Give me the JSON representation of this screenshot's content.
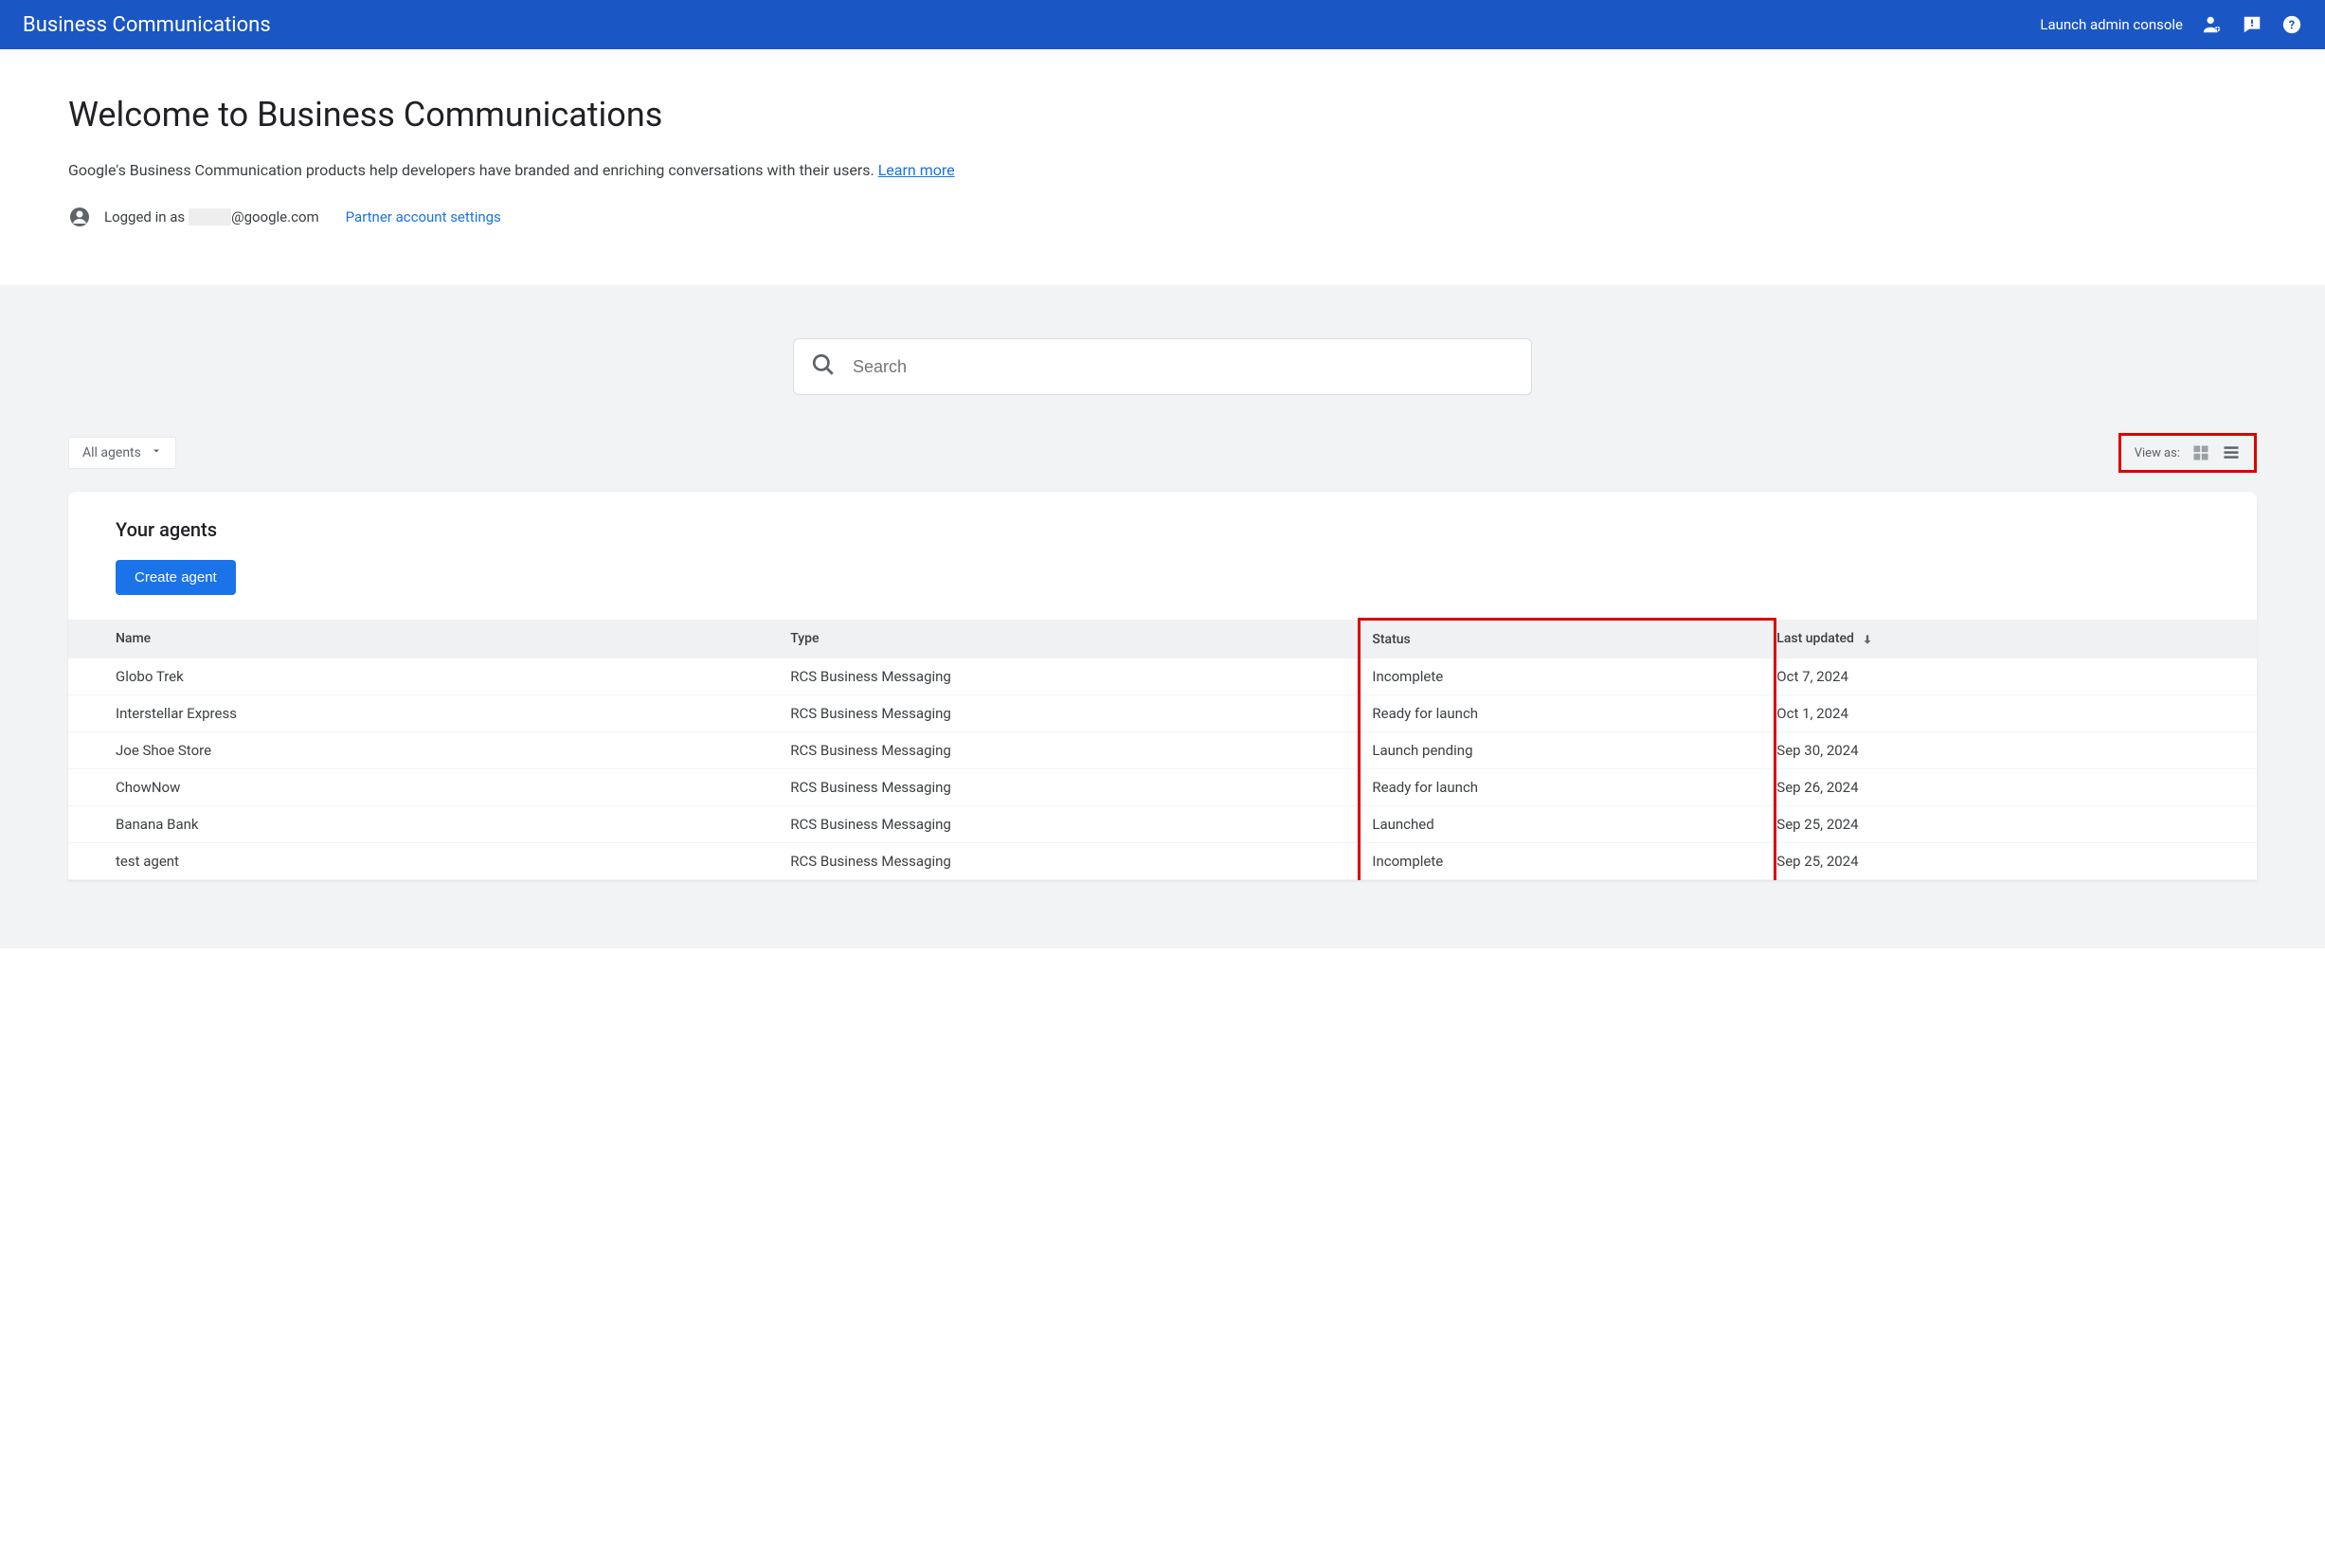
{
  "header": {
    "title": "Business Communications",
    "launch_link": "Launch admin console"
  },
  "welcome": {
    "title": "Welcome to Business Communications",
    "subtitle_prefix": "Google's Business Communication products help developers have branded and enriching conversations with their users. ",
    "learn_more": "Learn more",
    "logged_in_prefix": "Logged in as ",
    "logged_in_masked": "xxxxx",
    "logged_in_suffix": "@google.com",
    "partner_link": "Partner account settings"
  },
  "search": {
    "placeholder": "Search"
  },
  "controls": {
    "filter_label": "All agents",
    "view_label": "View as:"
  },
  "agents_card": {
    "title": "Your agents",
    "create_button": "Create agent"
  },
  "table": {
    "headers": {
      "name": "Name",
      "type": "Type",
      "status": "Status",
      "updated": "Last updated"
    },
    "rows": [
      {
        "name": "Globo Trek",
        "type": "RCS Business Messaging",
        "status": "Incomplete",
        "updated": "Oct 7, 2024"
      },
      {
        "name": "Interstellar Express",
        "type": "RCS Business Messaging",
        "status": "Ready for launch",
        "updated": "Oct 1, 2024"
      },
      {
        "name": "Joe Shoe Store",
        "type": "RCS Business Messaging",
        "status": "Launch pending",
        "updated": "Sep 30, 2024"
      },
      {
        "name": "ChowNow",
        "type": "RCS Business Messaging",
        "status": "Ready for launch",
        "updated": "Sep 26, 2024"
      },
      {
        "name": "Banana Bank",
        "type": "RCS Business Messaging",
        "status": "Launched",
        "updated": "Sep 25, 2024"
      },
      {
        "name": "test agent",
        "type": "RCS Business Messaging",
        "status": "Incomplete",
        "updated": "Sep 25, 2024"
      }
    ]
  }
}
